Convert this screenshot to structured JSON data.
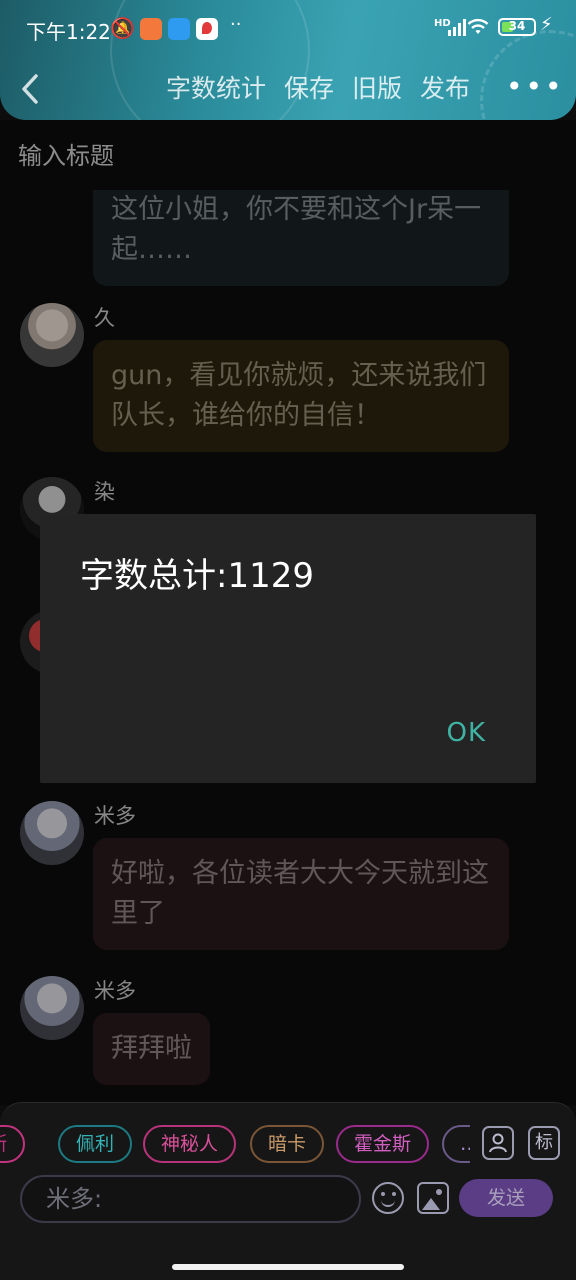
{
  "status_bar": {
    "time": "下午1:22",
    "hd_label": "HD",
    "battery": "34"
  },
  "header": {
    "buttons": [
      "字数统计",
      "保存",
      "旧版",
      "发布"
    ],
    "more": "•••"
  },
  "title_input": {
    "placeholder": "输入标题"
  },
  "messages": [
    {
      "text": "这位小姐，你不要和这个Jr呆一起……",
      "color": "blue"
    },
    {
      "name": "久",
      "text": "gun，看见你就烦，还来说我们队长，谁给你的自信！",
      "color": "yellow"
    },
    {
      "name": "染"
    },
    {
      "name": "米多",
      "text": "好啦，各位读者大大今天就到这里了",
      "color": "pink"
    },
    {
      "name": "米多",
      "text": "拜拜啦",
      "color": "pink"
    }
  ],
  "dialog": {
    "message": "字数总计:1129",
    "ok": "OK"
  },
  "character_chips": [
    "斯",
    "佩利",
    "神秘人",
    "暗卡",
    "霍金斯",
    "…"
  ],
  "tools": {
    "tag_label": "标"
  },
  "composer": {
    "placeholder": "米多:",
    "send": "发送"
  },
  "colors": {
    "accent_teal": "#3fb3a3",
    "send_button": "#5b3d86",
    "header_gradient": "#2a8a99"
  }
}
